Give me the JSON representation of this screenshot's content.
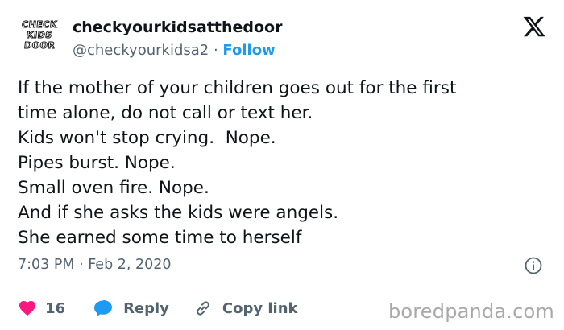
{
  "author": {
    "avatar_text": [
      "CHECK",
      "KIDS",
      "DOOR"
    ],
    "display_name": "checkyourkidsatthedoor",
    "handle": "@checkyourkidsa2",
    "separator": " · ",
    "follow_label": "Follow"
  },
  "tweet": {
    "lines": [
      "If the mother of your children goes out for the first",
      "time alone, do not call or text her.",
      "Kids won't stop crying.  Nope.",
      "Pipes burst. Nope.",
      "Small oven fire. Nope.",
      "And if she asks the kids were angels.",
      "She earned some time to herself"
    ],
    "timestamp": "7:03 PM · Feb 2, 2020"
  },
  "actions": {
    "like_count": "16",
    "reply_label": "Reply",
    "copy_link_label": "Copy link"
  },
  "watermark": "boredpanda.com",
  "icons": {
    "brand": "x-logo-icon",
    "info": "info-icon",
    "like": "heart-icon",
    "reply": "reply-bubble-icon",
    "copy": "link-icon"
  },
  "colors": {
    "accent": "#1d9bf0",
    "like": "#f91880",
    "secondary_text": "#536471",
    "divider": "#cfd9de"
  }
}
